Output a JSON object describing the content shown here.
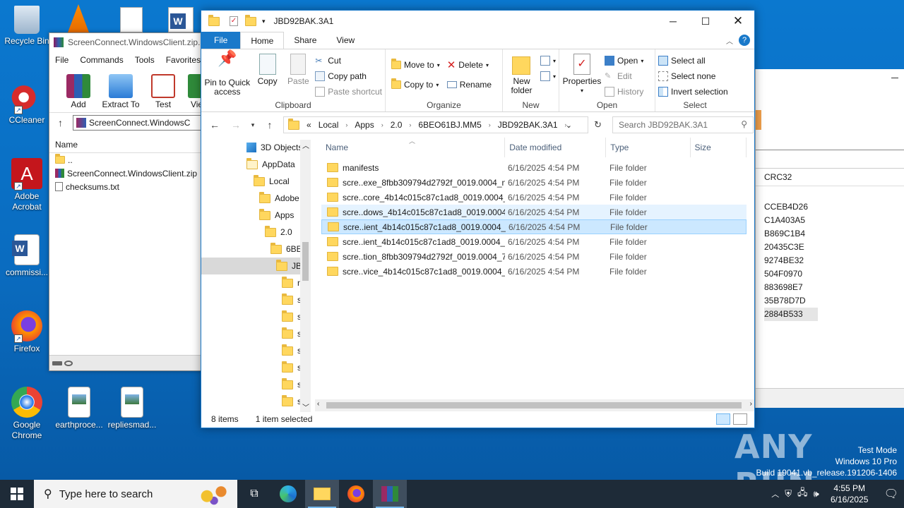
{
  "desktop": {
    "icons": [
      {
        "label": "Recycle Bin",
        "key": "recycle-bin"
      },
      {
        "label": "CCleaner",
        "key": "ccleaner"
      },
      {
        "label": "Adobe Acrobat",
        "key": "adobe-acrobat"
      },
      {
        "label": "commissi...",
        "key": "commission-doc"
      },
      {
        "label": "Firefox",
        "key": "firefox"
      },
      {
        "label": "Google Chrome",
        "key": "google-chrome"
      },
      {
        "label": "earthproce...",
        "key": "earthprocess-file"
      },
      {
        "label": "repliesmad...",
        "key": "repliesmade-file"
      }
    ]
  },
  "winrar": {
    "title": "ScreenConnect.WindowsClient.zip...",
    "menu": [
      "File",
      "Commands",
      "Tools",
      "Favorites"
    ],
    "tools": [
      "Add",
      "Extract To",
      "Test",
      "Vie"
    ],
    "path": "ScreenConnect.WindowsC",
    "col_name": "Name",
    "files": [
      "..",
      "ScreenConnect.WindowsClient.zip",
      "checksums.txt"
    ]
  },
  "right_window": {
    "crc_header": "CRC32",
    "crc_values": [
      "CCEB4D26",
      "C1A403A5",
      "B869C1B4",
      "20435C3E",
      "9274BE32",
      "504F0970",
      "883698E7",
      "35B78D7D",
      "2884B533"
    ]
  },
  "explorer": {
    "title": "JBD92BAK.3A1",
    "tabs": {
      "file": "File",
      "home": "Home",
      "share": "Share",
      "view": "View"
    },
    "clipboard": {
      "pin": "Pin to Quick access",
      "copy": "Copy",
      "paste": "Paste",
      "cut": "Cut",
      "copy_path": "Copy path",
      "paste_shortcut": "Paste shortcut",
      "label": "Clipboard"
    },
    "organize": {
      "move_to": "Move to",
      "copy_to": "Copy to",
      "delete": "Delete",
      "rename": "Rename",
      "label": "Organize"
    },
    "new": {
      "new_folder": "New folder",
      "label": "New"
    },
    "open": {
      "properties": "Properties",
      "open": "Open",
      "edit": "Edit",
      "history": "History",
      "label": "Open"
    },
    "select": {
      "select_all": "Select all",
      "select_none": "Select none",
      "invert": "Invert selection",
      "label": "Select"
    },
    "breadcrumb": [
      "«",
      "Local",
      "Apps",
      "2.0",
      "6BEO61BJ.MM5",
      "JBD92BAK.3A1"
    ],
    "search_placeholder": "Search JBD92BAK.3A1",
    "nav": [
      "3D Objects",
      "AppData",
      "Local",
      "Adobe",
      "Apps",
      "2.0",
      "6BEO",
      "JBD",
      "n",
      "s",
      "s",
      "s",
      "s",
      "s",
      "s",
      "s"
    ],
    "columns": {
      "name": "Name",
      "date": "Date modified",
      "type": "Type",
      "size": "Size"
    },
    "rows": [
      {
        "name": "manifests",
        "date": "6/16/2025 4:54 PM",
        "type": "File folder"
      },
      {
        "name": "scre..exe_8fbb309794d2792f_0019.0004_n...",
        "date": "6/16/2025 4:54 PM",
        "type": "File folder"
      },
      {
        "name": "scre..core_4b14c015c87c1ad8_0019.0004_...",
        "date": "6/16/2025 4:54 PM",
        "type": "File folder"
      },
      {
        "name": "scre..dows_4b14c015c87c1ad8_0019.0004...",
        "date": "6/16/2025 4:54 PM",
        "type": "File folder"
      },
      {
        "name": "scre..ient_4b14c015c87c1ad8_0019.0004_...",
        "date": "6/16/2025 4:54 PM",
        "type": "File folder"
      },
      {
        "name": "scre..ient_4b14c015c87c1ad8_0019.0004_...",
        "date": "6/16/2025 4:54 PM",
        "type": "File folder"
      },
      {
        "name": "scre..tion_8fbb309794d2792f_0019.0004_7...",
        "date": "6/16/2025 4:54 PM",
        "type": "File folder"
      },
      {
        "name": "scre..vice_4b14c015c87c1ad8_0019.0004_...",
        "date": "6/16/2025 4:54 PM",
        "type": "File folder"
      }
    ],
    "status_items": "8 items",
    "status_selected": "1 item selected"
  },
  "taskbar": {
    "search_placeholder": "Type here to search",
    "time": "4:55 PM",
    "date": "6/16/2025"
  },
  "watermark": {
    "brand": "ANY RUN",
    "mode": "Test Mode",
    "os": "Windows 10 Pro",
    "build": "Build 19041.vb_release.191206-1406"
  }
}
